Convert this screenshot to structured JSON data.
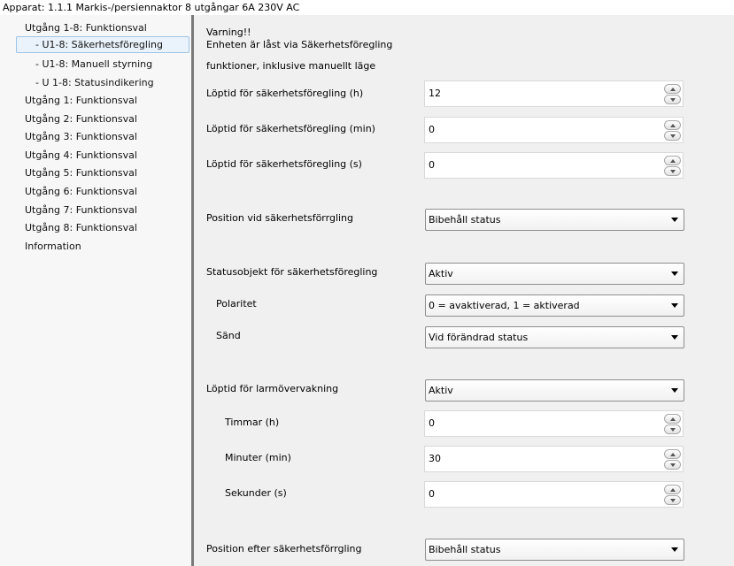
{
  "window": {
    "title": "Apparat: 1.1.1  Markis-/persiennaktor 8 utgångar 6A 230V AC"
  },
  "sidebar": {
    "items": [
      {
        "label": "Utgång 1-8: Funktionsval"
      },
      {
        "label": "- U1-8: Säkerhetsföregling"
      },
      {
        "label": "- U1-8: Manuell styrning"
      },
      {
        "label": "- U 1-8: Statusindikering"
      },
      {
        "label": "Utgång 1: Funktionsval"
      },
      {
        "label": "Utgång 2: Funktionsval"
      },
      {
        "label": "Utgång 3: Funktionsval"
      },
      {
        "label": "Utgång 4: Funktionsval"
      },
      {
        "label": "Utgång 5: Funktionsval"
      },
      {
        "label": "Utgång 6: Funktionsval"
      },
      {
        "label": "Utgång 7: Funktionsval"
      },
      {
        "label": "Utgång 8: Funktionsval"
      },
      {
        "label": "Information"
      }
    ]
  },
  "main": {
    "warning_line1": "Varning!!",
    "warning_line2": "Enheten är låst via Säkerhetsföregling",
    "warning_line3": "funktioner, inklusive manuellt läge",
    "runtime_h": {
      "label": "Löptid för säkerhetsföregling (h)",
      "value": "12"
    },
    "runtime_min": {
      "label": "Löptid för säkerhetsföregling (min)",
      "value": "0"
    },
    "runtime_s": {
      "label": "Löptid för säkerhetsföregling (s)",
      "value": "0"
    },
    "position_during": {
      "label": "Position vid säkerhetsförrgling",
      "value": "Bibehåll status"
    },
    "status_object": {
      "label": "Statusobjekt för säkerhetsföregling",
      "value": "Aktiv"
    },
    "polarity": {
      "label": "Polaritet",
      "value": "0 = avaktiverad, 1 = aktiverad"
    },
    "send": {
      "label": "Sänd",
      "value": "Vid förändrad status"
    },
    "alarm_runtime": {
      "label": "Löptid för larmövervakning",
      "value": "Aktiv"
    },
    "hours": {
      "label": "Timmar (h)",
      "value": "0"
    },
    "minutes": {
      "label": "Minuter (min)",
      "value": "30"
    },
    "seconds": {
      "label": "Sekunder (s)",
      "value": "0"
    },
    "position_after": {
      "label": "Position efter säkerhetsförrgling",
      "value": "Bibehåll status"
    }
  }
}
